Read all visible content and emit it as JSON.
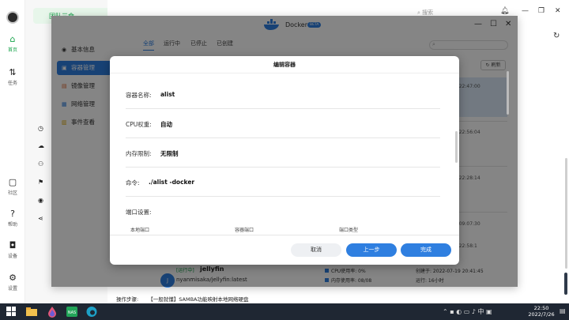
{
  "rail": {
    "items": [
      {
        "label": "首页",
        "icon": "home-icon"
      },
      {
        "label": "任务",
        "icon": "task-icon"
      },
      {
        "label": "社区",
        "icon": "community-icon"
      },
      {
        "label": "帮助",
        "icon": "help-icon"
      },
      {
        "label": "设备",
        "icon": "device-icon"
      },
      {
        "label": "设置",
        "icon": "settings-icon"
      }
    ]
  },
  "background": {
    "sidebar_selected": "团队三命",
    "search_placeholder": "搜索"
  },
  "docker": {
    "title": "Docker",
    "beta": "BETA",
    "nav": [
      {
        "label": "基本信息"
      },
      {
        "label": "容器管理"
      },
      {
        "label": "镜像管理"
      },
      {
        "label": "网络管理"
      },
      {
        "label": "事件查看"
      }
    ],
    "tabs": [
      "全部",
      "运行中",
      "已停止",
      "已创建"
    ],
    "refresh": "刷新",
    "timestamps": [
      "5 22:47:00",
      "5 22:56:04",
      "5 22:28:14",
      "4 09:07:30",
      "5 22:58:1"
    ],
    "jellyfin": {
      "status": "[运行中]",
      "name": "jellyfin",
      "image": "nyanmisaka/jellyfin:latest",
      "cpu": "CPU使用率: 0%",
      "mem": "内存使用率: 08/08",
      "created": "创建于: 2022-07-19 20:41:45",
      "running": "运行: 16小时"
    }
  },
  "dialog": {
    "title": "编辑容器",
    "fields": [
      {
        "label": "容器名称:",
        "value": "alist"
      },
      {
        "label": "CPU权重:",
        "value": "自动"
      },
      {
        "label": "内存限制:",
        "value": "无限制"
      },
      {
        "label": "命令:",
        "value": "./alist -docker"
      }
    ],
    "ports_label": "端口设置:",
    "port_columns": [
      "本地端口",
      "容器端口",
      "端口类型"
    ],
    "buttons": {
      "cancel": "取消",
      "prev": "上一步",
      "done": "完成"
    }
  },
  "status_line": {
    "left": "操作步骤:",
    "right": "【一般就懂】SAMBA功能映射本地网络硬盘"
  },
  "taskbar": {
    "time": "22:50",
    "date": "2022/7/26",
    "tray_lang": "中"
  }
}
